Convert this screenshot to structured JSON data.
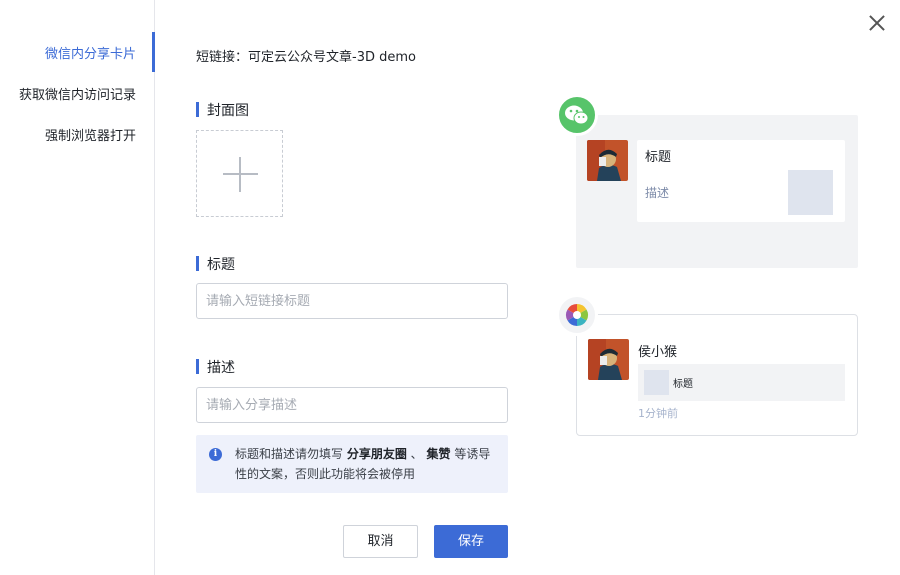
{
  "sidebar": {
    "items": [
      {
        "label": "微信内分享卡片",
        "active": true
      },
      {
        "label": "获取微信内访问记录",
        "active": false
      },
      {
        "label": "强制浏览器打开",
        "active": false
      }
    ]
  },
  "form": {
    "short_link": "短链接：可定云公众号文章-3D demo",
    "cover_label": "封面图",
    "title_label": "标题",
    "title_placeholder": "请输入短链接标题",
    "desc_label": "描述",
    "desc_placeholder": "请输入分享描述",
    "notice": {
      "prefix": "标题和描述请勿填写 ",
      "bold_1": "分享朋友圈",
      "sep": " 、 ",
      "bold_2": "集赞",
      "suffix": " 等诱导性的文案，否则此功能将会被停用"
    },
    "cancel_label": "取消",
    "save_label": "保存"
  },
  "preview": {
    "wechat": {
      "title": "标题",
      "desc": "描述"
    },
    "moments": {
      "user": "侯小猴",
      "link_title": "标题",
      "time": "1分钟前"
    }
  },
  "colors": {
    "accent": "#3c6bd6",
    "wechat_green": "#57c46a",
    "notice_bg": "#eef1fb"
  },
  "icons": [
    "close-icon",
    "plus-icon",
    "info-icon",
    "wechat-icon",
    "moments-icon"
  ]
}
